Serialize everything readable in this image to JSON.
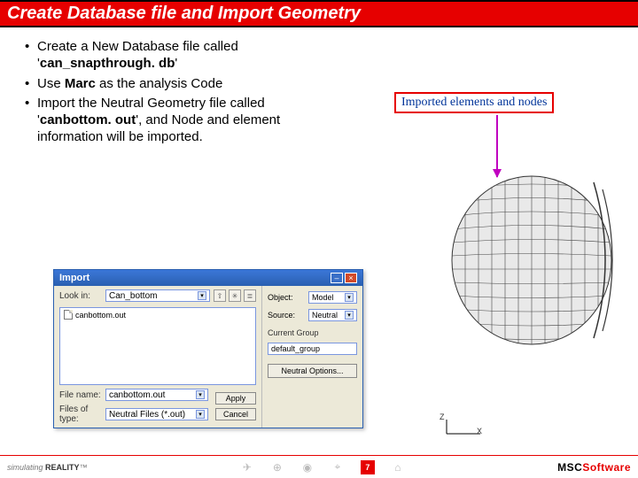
{
  "title": "Create Database file and Import Geometry",
  "bullets": [
    {
      "pre": "Create a New Database file called '",
      "bold": "can_snapthrough. db",
      "post": "'"
    },
    {
      "pre": "Use ",
      "bold": "Marc",
      "post": " as the analysis Code"
    },
    {
      "pre": "Import the Neutral Geometry file called '",
      "bold": "canbottom. out",
      "post": "', and Node and element information will be imported."
    }
  ],
  "callout": "Imported elements and nodes",
  "dialog": {
    "title": "Import",
    "lookin_label": "Look in:",
    "lookin_value": "Can_bottom",
    "file_shown": "canbottom.out",
    "filename_label": "File name:",
    "filename_value": "canbottom.out",
    "filetype_label": "Files of type:",
    "filetype_value": "Neutral Files (*.out)",
    "apply": "Apply",
    "cancel": "Cancel",
    "object_label": "Object:",
    "object_value": "Model",
    "source_label": "Source:",
    "source_value": "Neutral",
    "group_label": "Current Group",
    "group_value": "default_group",
    "options_btn": "Neutral Options..."
  },
  "axis": {
    "z": "Z",
    "x": "X"
  },
  "footer": {
    "tag_italic": "simulating",
    "tag_bold": "REALITY",
    "tm": "™",
    "page": "7",
    "brand_pre": "MSC",
    "brand_red": "Software"
  }
}
